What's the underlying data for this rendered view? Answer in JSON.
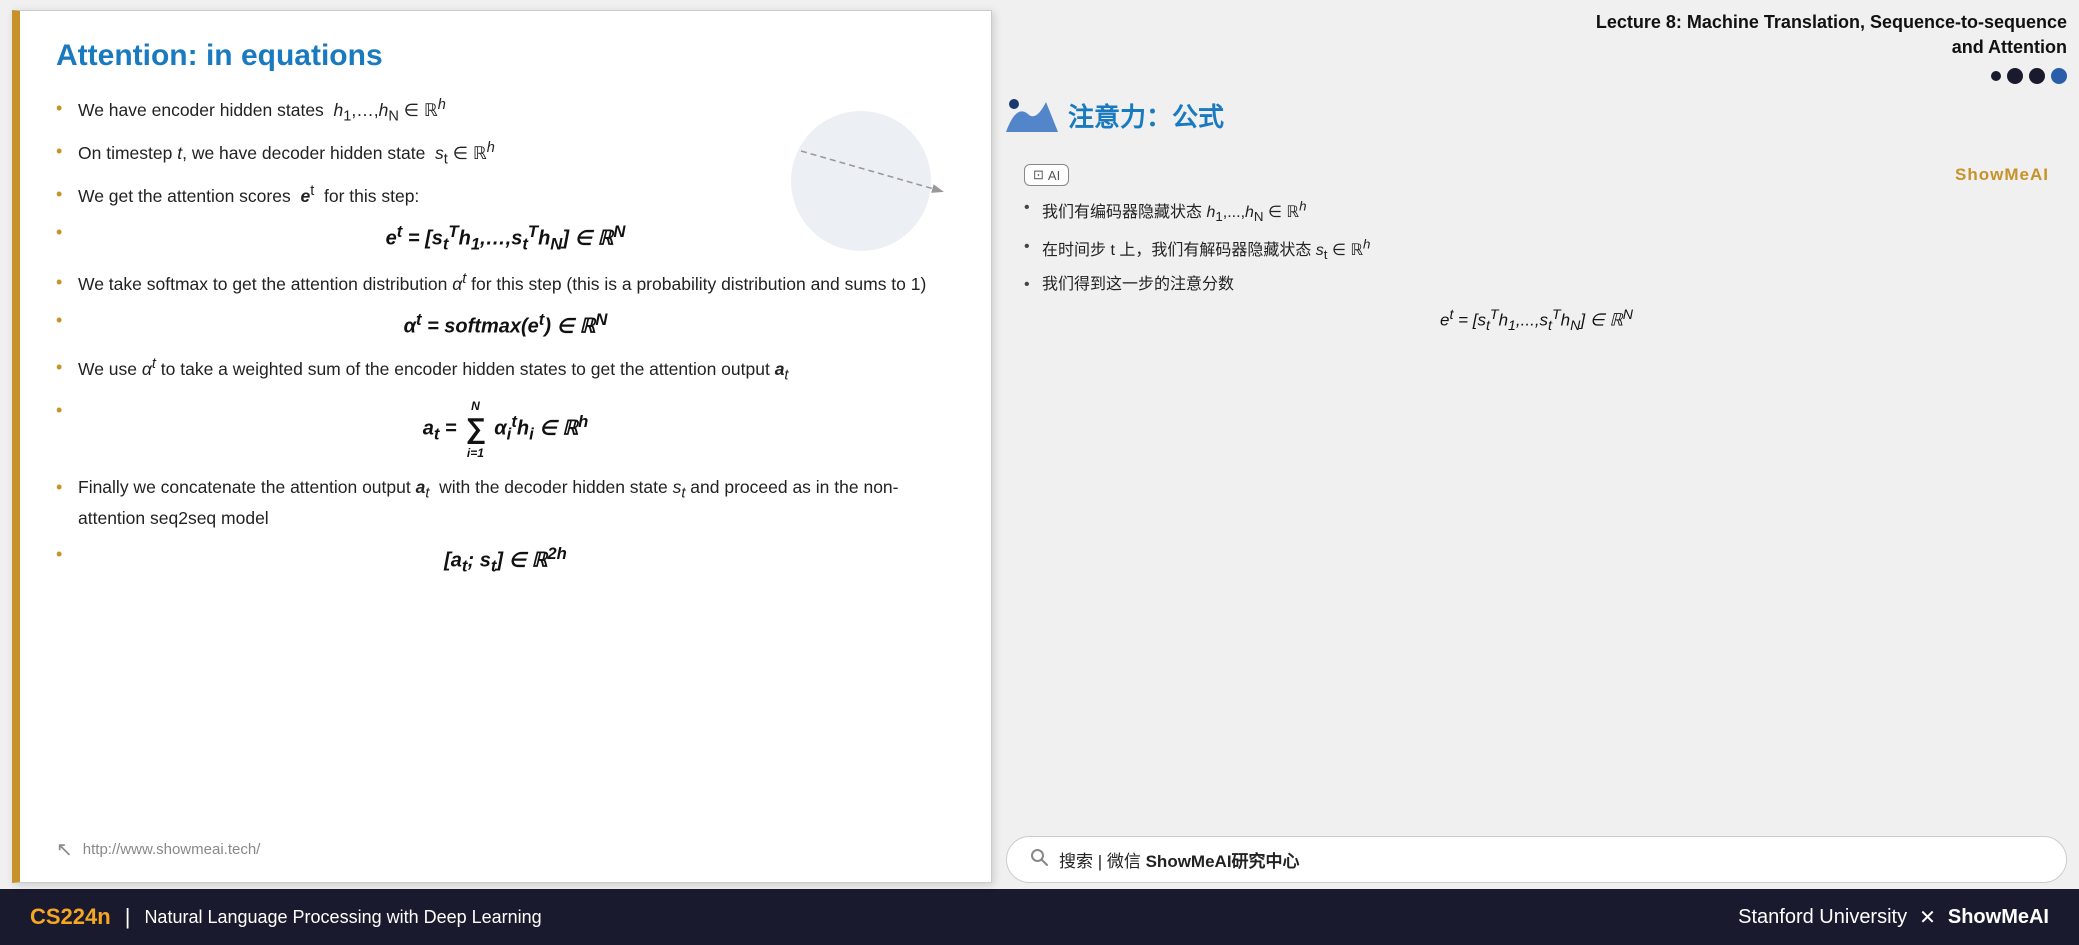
{
  "slide": {
    "title": "Attention: in equations",
    "bullets": [
      {
        "text_before": "We have encoder hidden states ",
        "math": "h₁,…,hₙ ∈ ℝʰ",
        "text_after": ""
      },
      {
        "text_before": "On timestep ",
        "math_t": "t",
        "text_mid": ", we have decoder hidden state ",
        "math_s": "sₜ ∈ ℝʰ",
        "text_after": ""
      },
      {
        "text_before": "We get the attention scores ",
        "math": "eᵗ",
        "text_after": "  for this step:"
      },
      {
        "formula": "eᵗ = [sₜᵀh₁,…,sₜᵀhₙ] ∈ ℝᴺ",
        "is_formula": true
      },
      {
        "text_before": "We take softmax to get the attention distribution ",
        "math": "αᵗ",
        "text_after": " for this step (this is a probability distribution and sums to 1)"
      },
      {
        "formula": "αᵗ = softmax(eᵗ) ∈ ℝᴺ",
        "is_formula": true
      },
      {
        "text_before": "We use ",
        "math": "αᵗ",
        "text_after": " to take a weighted sum of the encoder hidden states to get the attention output ",
        "math2": "aₜ"
      },
      {
        "formula": "aₜ = Σᵢ₌₁ᴺ αᵢᵗ hᵢ ∈ ℝʰ",
        "is_formula": true
      },
      {
        "text_before": "Finally we concatenate the attention output ",
        "math": "aₜ",
        "text_after": " with the decoder hidden state ",
        "math2": "sₜ",
        "text_after2": " and proceed as in the non-attention seq2seq model"
      },
      {
        "formula": "[aₜ; sₜ] ∈ ℝ²ʰ",
        "is_formula": true
      }
    ],
    "footer_url": "http://www.showmeai.tech/"
  },
  "lecture": {
    "title_line1": "Lecture 8:  Machine Translation, Sequence-to-sequence",
    "title_line2": "and Attention"
  },
  "chinese_section": {
    "title": "注意力：公式",
    "ai_badge": "AI",
    "showmeai_label": "ShowMeAI",
    "bullets": [
      "我们有编码器隐藏状态 h₁,...,hₙ ∈ ℝʰ",
      "在时间步 t 上，我们有解码器隐藏状态 sₜ ∈ ℝʰ",
      "我们得到这一步的注意分数"
    ],
    "formula": "eᵗ = [sₜᵀh₁,...,sₜᵀhₙ] ∈ ℝᴺ"
  },
  "search": {
    "placeholder": "搜索 | 微信 ShowMeAI研究中心"
  },
  "footer": {
    "cs224n": "CS224n",
    "divider": "|",
    "subtitle": "Natural Language Processing with Deep Learning",
    "right": "Stanford University  ✕  ShowMeAI"
  }
}
